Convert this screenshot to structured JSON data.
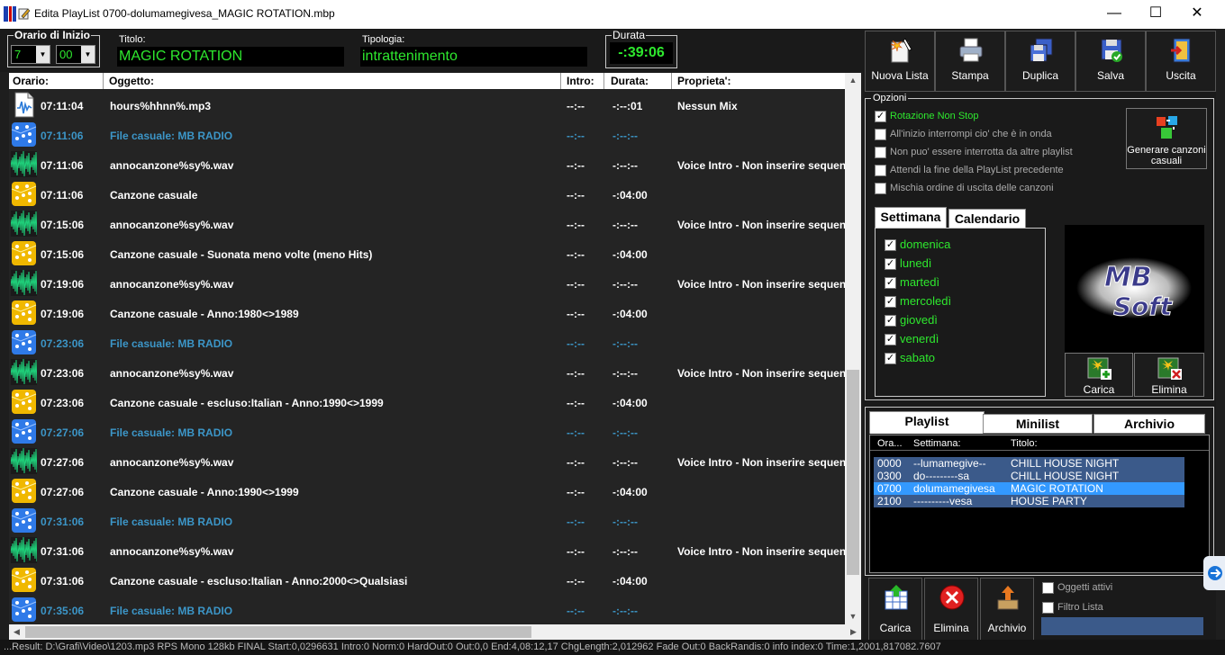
{
  "window": {
    "title": "Edita PlayList 0700-dolumamegivesa_MAGIC ROTATION.mbp",
    "minimize": "—",
    "maximize": "☐",
    "close": "✕"
  },
  "header": {
    "orario_legend": "Orario di Inizio",
    "hour_value": "7",
    "minute_value": "00",
    "titolo_label": "Titolo:",
    "titolo_value": "MAGIC ROTATION",
    "tipologia_label": "Tipologia:",
    "tipologia_value": "intrattenimento",
    "durata_legend": "Durata",
    "durata_value": "-:39:06"
  },
  "list": {
    "columns": [
      "Orario:",
      "Oggetto:",
      "Intro:",
      "Durata:",
      "Proprieta':"
    ],
    "rows": [
      {
        "icon": "audio-file-icon",
        "time": "07:11:04",
        "object": "hours%hhnn%.mp3",
        "intro": "--:--",
        "duration": "-:--:01",
        "prop": "Nessun Mix",
        "style": "white"
      },
      {
        "icon": "dice-blue-icon",
        "time": "07:11:06",
        "object": "File casuale: MB RADIO",
        "intro": "--:--",
        "duration": "-:--:--",
        "prop": "",
        "style": "blue"
      },
      {
        "icon": "waveform-icon",
        "time": "07:11:06",
        "object": "annocanzone%sy%.wav",
        "intro": "--:--",
        "duration": "-:--:--",
        "prop": "Voice Intro - Non inserire sequen",
        "style": "white"
      },
      {
        "icon": "dice-yellow-icon",
        "time": "07:11:06",
        "object": "Canzone casuale",
        "intro": "--:--",
        "duration": "-:04:00",
        "prop": "",
        "style": "white"
      },
      {
        "icon": "waveform-icon",
        "time": "07:15:06",
        "object": "annocanzone%sy%.wav",
        "intro": "--:--",
        "duration": "-:--:--",
        "prop": "Voice Intro - Non inserire sequen",
        "style": "white"
      },
      {
        "icon": "dice-yellow-icon",
        "time": "07:15:06",
        "object": "Canzone casuale - Suonata meno volte (meno Hits)",
        "intro": "--:--",
        "duration": "-:04:00",
        "prop": "",
        "style": "white"
      },
      {
        "icon": "waveform-icon",
        "time": "07:19:06",
        "object": "annocanzone%sy%.wav",
        "intro": "--:--",
        "duration": "-:--:--",
        "prop": "Voice Intro - Non inserire sequen",
        "style": "white"
      },
      {
        "icon": "dice-yellow-icon",
        "time": "07:19:06",
        "object": "Canzone casuale - Anno:1980<>1989",
        "intro": "--:--",
        "duration": "-:04:00",
        "prop": "",
        "style": "white"
      },
      {
        "icon": "dice-blue-icon",
        "time": "07:23:06",
        "object": "File casuale: MB RADIO",
        "intro": "--:--",
        "duration": "-:--:--",
        "prop": "",
        "style": "blue"
      },
      {
        "icon": "waveform-icon",
        "time": "07:23:06",
        "object": "annocanzone%sy%.wav",
        "intro": "--:--",
        "duration": "-:--:--",
        "prop": "Voice Intro - Non inserire sequen",
        "style": "white"
      },
      {
        "icon": "dice-yellow-icon",
        "time": "07:23:06",
        "object": "Canzone casuale - escluso:Italian - Anno:1990<>1999",
        "intro": "--:--",
        "duration": "-:04:00",
        "prop": "",
        "style": "white"
      },
      {
        "icon": "dice-blue-icon",
        "time": "07:27:06",
        "object": "File casuale: MB RADIO",
        "intro": "--:--",
        "duration": "-:--:--",
        "prop": "",
        "style": "blue"
      },
      {
        "icon": "waveform-icon",
        "time": "07:27:06",
        "object": "annocanzone%sy%.wav",
        "intro": "--:--",
        "duration": "-:--:--",
        "prop": "Voice Intro - Non inserire sequen",
        "style": "white"
      },
      {
        "icon": "dice-yellow-icon",
        "time": "07:27:06",
        "object": "Canzone casuale - Anno:1990<>1999",
        "intro": "--:--",
        "duration": "-:04:00",
        "prop": "",
        "style": "white"
      },
      {
        "icon": "dice-blue-icon",
        "time": "07:31:06",
        "object": "File casuale: MB RADIO",
        "intro": "--:--",
        "duration": "-:--:--",
        "prop": "",
        "style": "blue"
      },
      {
        "icon": "waveform-icon",
        "time": "07:31:06",
        "object": "annocanzone%sy%.wav",
        "intro": "--:--",
        "duration": "-:--:--",
        "prop": "Voice Intro - Non inserire sequen",
        "style": "white"
      },
      {
        "icon": "dice-yellow-icon",
        "time": "07:31:06",
        "object": "Canzone casuale - escluso:Italian - Anno:2000<>Qualsiasi",
        "intro": "--:--",
        "duration": "-:04:00",
        "prop": "",
        "style": "white"
      },
      {
        "icon": "dice-blue-icon",
        "time": "07:35:06",
        "object": "File casuale: MB RADIO",
        "intro": "--:--",
        "duration": "-:--:--",
        "prop": "",
        "style": "blue"
      }
    ]
  },
  "toolbar": {
    "nuova_lista": "Nuova Lista",
    "stampa": "Stampa",
    "duplica": "Duplica",
    "salva": "Salva",
    "uscita": "Uscita"
  },
  "opzioni": {
    "legend": "Opzioni",
    "items": [
      {
        "label": "Rotazione Non Stop",
        "checked": true
      },
      {
        "label": "All'inizio interrompi cio' che è in onda",
        "checked": false
      },
      {
        "label": "Non puo' essere interrotta da altre playlist",
        "checked": false
      },
      {
        "label": "Attendi la fine della PlayList precedente",
        "checked": false
      },
      {
        "label": "Mischia ordine di uscita delle canzoni",
        "checked": false
      }
    ],
    "generare_label": "Generare canzoni casuali"
  },
  "schedule": {
    "tab_settimana": "Settimana",
    "tab_calendario": "Calendario",
    "days": [
      "domenica",
      "lunedì",
      "martedì",
      "mercoledì",
      "giovedì",
      "venerdì",
      "sabato"
    ]
  },
  "logo": {
    "text": "MB Soft",
    "carica": "Carica",
    "elimina": "Elimina"
  },
  "playlist_panel": {
    "tabs": [
      "Playlist",
      "Minilist",
      "Archivio"
    ],
    "columns": [
      "Ora...",
      "Settimana:",
      "Titolo:"
    ],
    "rows": [
      {
        "ora": "0000",
        "sett": "--lumamegive--",
        "titolo": "CHILL HOUSE NIGHT",
        "selected": false
      },
      {
        "ora": "0300",
        "sett": "do---------sa",
        "titolo": "CHILL HOUSE NIGHT",
        "selected": false
      },
      {
        "ora": "0700",
        "sett": "dolumamegivesa",
        "titolo": "MAGIC ROTATION",
        "selected": true
      },
      {
        "ora": "2100",
        "sett": "----------vesa",
        "titolo": "HOUSE PARTY",
        "selected": false
      }
    ]
  },
  "bottom": {
    "carica": "Carica",
    "elimina": "Elimina",
    "archivio": "Archivio",
    "oggetti_attivi": "Oggetti attivi",
    "filtro_lista": "Filtro Lista"
  },
  "status_text": "...Result: D:\\Grafi\\Video\\1203.mp3  RPS  Mono  128kb  FINAL  Start:0,0296631  Intro:0  Norm:0  HardOut:0  Out:0,0  End:4,08:12,17  ChgLength:2,012962  Fade Out:0  BackRandis:0  info index:0  Time:1,2001,817082.7607"
}
